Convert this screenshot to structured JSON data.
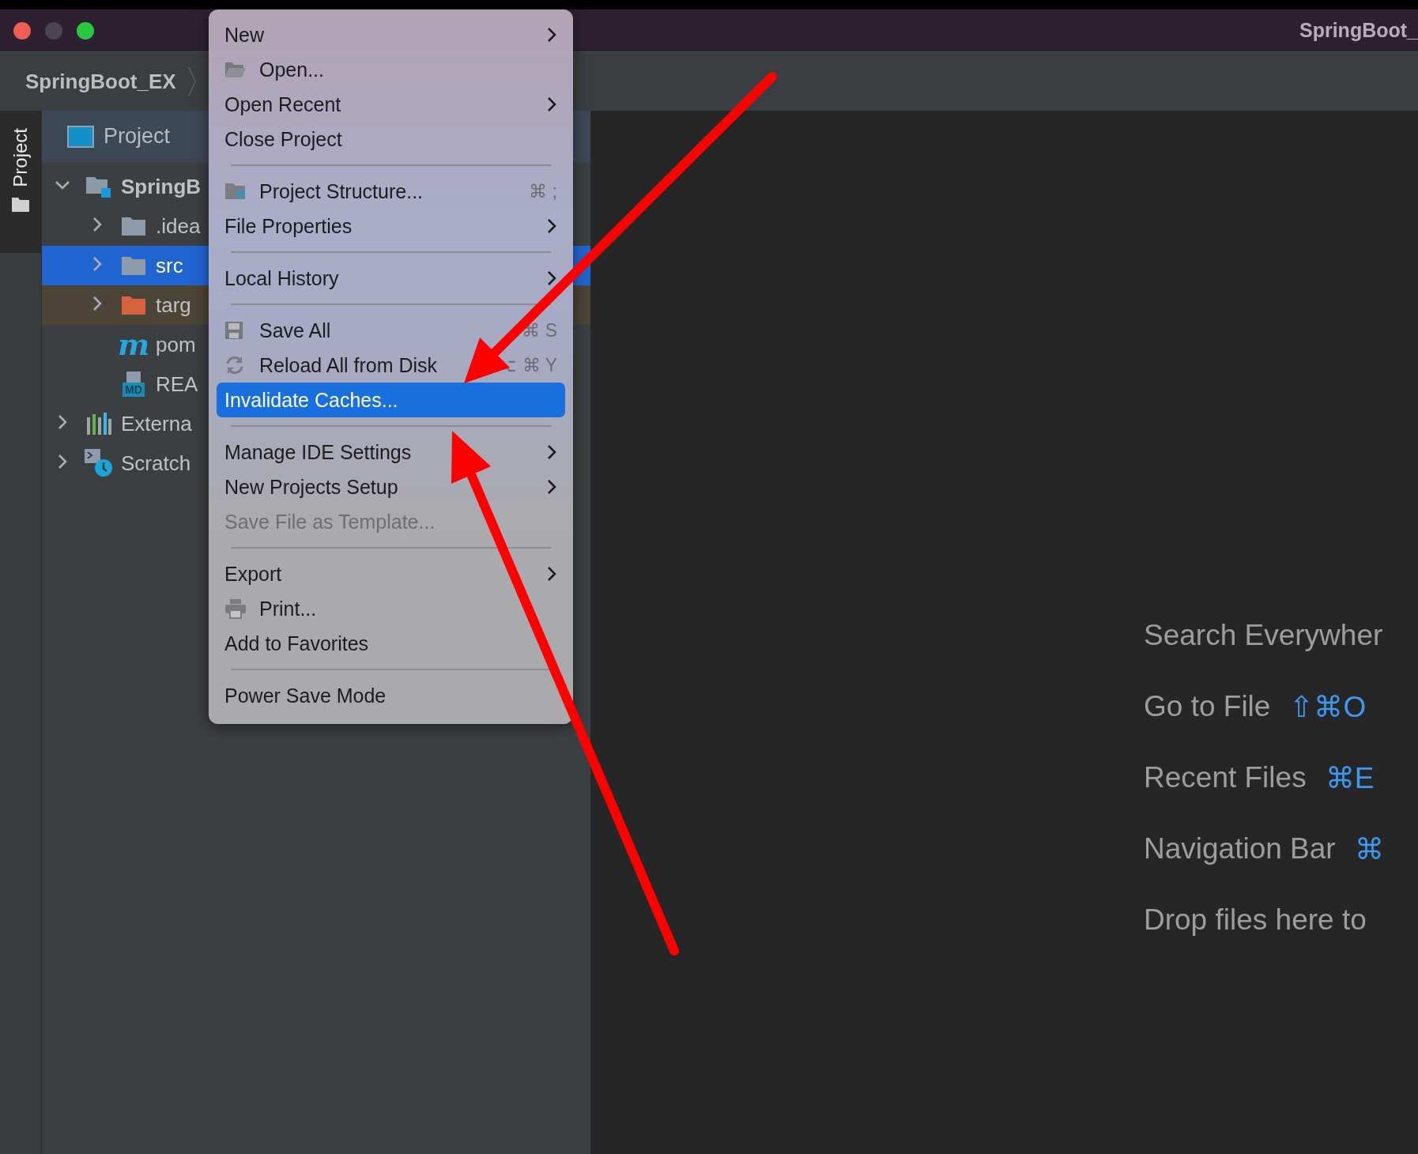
{
  "window": {
    "title": "SpringBoot_"
  },
  "navbar": {
    "breadcrumb": "SpringBoot_EX"
  },
  "tool_strip": {
    "label": "Project"
  },
  "project_panel": {
    "title": "Project",
    "tree": [
      {
        "label": "SpringB",
        "kind": "module",
        "expanded": true,
        "selected": false,
        "children": [
          {
            "label": ".idea",
            "kind": "folder",
            "expanded": false,
            "selected": false
          },
          {
            "label": "src",
            "kind": "folder",
            "expanded": false,
            "selected": true
          },
          {
            "label": "targ",
            "kind": "excluded-folder",
            "expanded": false,
            "selected": false
          },
          {
            "label": "pom",
            "kind": "maven",
            "icon_text": "m",
            "selected": false
          },
          {
            "label": "REA",
            "kind": "markdown",
            "icon_text": "MD",
            "selected": false
          }
        ]
      },
      {
        "label": "Externa",
        "kind": "libraries",
        "expanded": false,
        "selected": false
      },
      {
        "label": "Scratch",
        "kind": "scratches",
        "expanded": false,
        "selected": false
      }
    ]
  },
  "menu": {
    "items": [
      {
        "kind": "item",
        "label": "New",
        "submenu": true,
        "disabled": false,
        "selected": false
      },
      {
        "kind": "open",
        "label": "Open...",
        "disabled": false,
        "selected": false
      },
      {
        "kind": "item",
        "label": "Open Recent",
        "submenu": true,
        "disabled": false,
        "selected": false
      },
      {
        "kind": "item",
        "label": "Close Project",
        "disabled": false,
        "selected": false
      },
      {
        "kind": "separator"
      },
      {
        "kind": "structure",
        "label": "Project Structure...",
        "shortcut": "⌘ ;",
        "disabled": false,
        "selected": false
      },
      {
        "kind": "item",
        "label": "File Properties",
        "submenu": true,
        "disabled": false,
        "selected": false
      },
      {
        "kind": "separator"
      },
      {
        "kind": "item",
        "label": "Local History",
        "submenu": true,
        "disabled": false,
        "selected": false
      },
      {
        "kind": "separator"
      },
      {
        "kind": "save",
        "label": "Save All",
        "shortcut": "⌘ S",
        "disabled": false,
        "selected": false
      },
      {
        "kind": "reload",
        "label": "Reload All from Disk",
        "shortcut": "⌥ ⌘ Y",
        "disabled": false,
        "selected": false
      },
      {
        "kind": "item",
        "label": "Invalidate Caches...",
        "disabled": false,
        "selected": true
      },
      {
        "kind": "separator"
      },
      {
        "kind": "item",
        "label": "Manage IDE Settings",
        "submenu": true,
        "disabled": false,
        "selected": false
      },
      {
        "kind": "item",
        "label": "New Projects Setup",
        "submenu": true,
        "disabled": false,
        "selected": false
      },
      {
        "kind": "item",
        "label": "Save File as Template...",
        "disabled": true,
        "selected": false
      },
      {
        "kind": "separator"
      },
      {
        "kind": "item",
        "label": "Export",
        "submenu": true,
        "disabled": false,
        "selected": false
      },
      {
        "kind": "print",
        "label": "Print...",
        "disabled": false,
        "selected": false
      },
      {
        "kind": "item",
        "label": "Add to Favorites",
        "disabled": false,
        "selected": false
      },
      {
        "kind": "separator"
      },
      {
        "kind": "item",
        "label": "Power Save Mode",
        "disabled": false,
        "selected": false
      }
    ]
  },
  "editor_hints": [
    {
      "label": "Search Everywher"
    },
    {
      "label": "Go to File",
      "shortcut": "⇧⌘O"
    },
    {
      "label": "Recent Files",
      "shortcut": "⌘E"
    },
    {
      "label": "Navigation Bar",
      "shortcut": "⌘"
    },
    {
      "label": "Drop files here to"
    }
  ]
}
